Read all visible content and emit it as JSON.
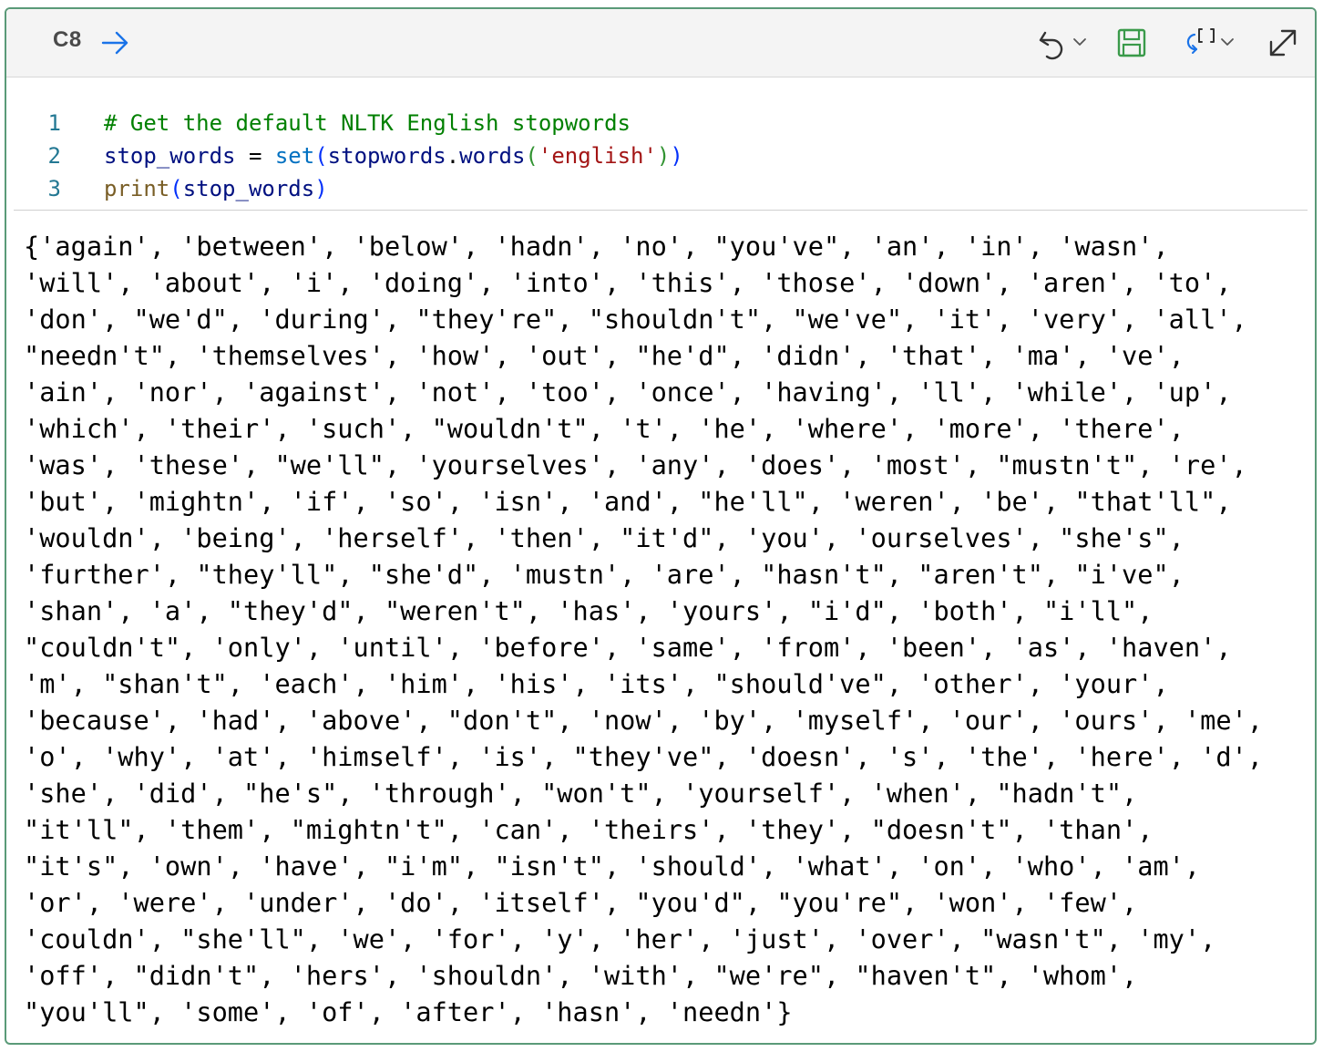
{
  "cell": {
    "id_label": "C8"
  },
  "toolbar": {
    "run_icon": "arrow-right-icon",
    "undo_icon": "undo-icon",
    "save_icon": "save-icon",
    "variables_icon": "variables-icon",
    "expand_icon": "expand-icon"
  },
  "colors": {
    "border": "#5a9a78",
    "accent_blue": "#1a73e8",
    "save_green": "#3a9a4a"
  },
  "code": {
    "lines": [
      {
        "number": "1",
        "tokens": [
          {
            "cls": "c-comment",
            "text": "# Get the default NLTK English stopwords"
          }
        ]
      },
      {
        "number": "2",
        "tokens": [
          {
            "cls": "c-var",
            "text": "stop_words"
          },
          {
            "cls": "c-op",
            "text": " = "
          },
          {
            "cls": "c-builtin",
            "text": "set"
          },
          {
            "cls": "c-p1",
            "text": "("
          },
          {
            "cls": "c-var",
            "text": "stopwords"
          },
          {
            "cls": "c-op",
            "text": "."
          },
          {
            "cls": "c-var",
            "text": "words"
          },
          {
            "cls": "c-p2",
            "text": "("
          },
          {
            "cls": "c-str",
            "text": "'english'"
          },
          {
            "cls": "c-p2",
            "text": ")"
          },
          {
            "cls": "c-p1",
            "text": ")"
          }
        ]
      },
      {
        "number": "3",
        "tokens": [
          {
            "cls": "c-fn",
            "text": "print"
          },
          {
            "cls": "c-p1",
            "text": "("
          },
          {
            "cls": "c-var",
            "text": "stop_words"
          },
          {
            "cls": "c-p1",
            "text": ")"
          }
        ]
      }
    ]
  },
  "output": {
    "lines": [
      "{'again', 'between', 'below', 'hadn', 'no', \"you've\", 'an', 'in', 'wasn',",
      "'will', 'about', 'i', 'doing', 'into', 'this', 'those', 'down', 'aren', 'to',",
      "'don', \"we'd\", 'during', \"they're\", \"shouldn't\", \"we've\", 'it', 'very', 'all',",
      "\"needn't\", 'themselves', 'how', 'out', \"he'd\", 'didn', 'that', 'ma', 've',",
      "'ain', 'nor', 'against', 'not', 'too', 'once', 'having', 'll', 'while', 'up',",
      "'which', 'their', 'such', \"wouldn't\", 't', 'he', 'where', 'more', 'there',",
      "'was', 'these', \"we'll\", 'yourselves', 'any', 'does', 'most', \"mustn't\", 're',",
      "'but', 'mightn', 'if', 'so', 'isn', 'and', \"he'll\", 'weren', 'be', \"that'll\",",
      "'wouldn', 'being', 'herself', 'then', \"it'd\", 'you', 'ourselves', \"she's\",",
      "'further', \"they'll\", \"she'd\", 'mustn', 'are', \"hasn't\", \"aren't\", \"i've\",",
      "'shan', 'a', \"they'd\", \"weren't\", 'has', 'yours', \"i'd\", 'both', \"i'll\",",
      "\"couldn't\", 'only', 'until', 'before', 'same', 'from', 'been', 'as', 'haven',",
      "'m', \"shan't\", 'each', 'him', 'his', 'its', \"should've\", 'other', 'your',",
      "'because', 'had', 'above', \"don't\", 'now', 'by', 'myself', 'our', 'ours', 'me',",
      "'o', 'why', 'at', 'himself', 'is', \"they've\", 'doesn', 's', 'the', 'here', 'd',",
      "'she', 'did', \"he's\", 'through', \"won't\", 'yourself', 'when', \"hadn't\",",
      "\"it'll\", 'them', \"mightn't\", 'can', 'theirs', 'they', \"doesn't\", 'than',",
      "\"it's\", 'own', 'have', \"i'm\", \"isn't\", 'should', 'what', 'on', 'who', 'am',",
      "'or', 'were', 'under', 'do', 'itself', \"you'd\", \"you're\", 'won', 'few',",
      "'couldn', \"she'll\", 'we', 'for', 'y', 'her', 'just', 'over', \"wasn't\", 'my',",
      "'off', \"didn't\", 'hers', 'shouldn', 'with', \"we're\", \"haven't\", 'whom',",
      "\"you'll\", 'some', 'of', 'after', 'hasn', 'needn'}"
    ]
  }
}
